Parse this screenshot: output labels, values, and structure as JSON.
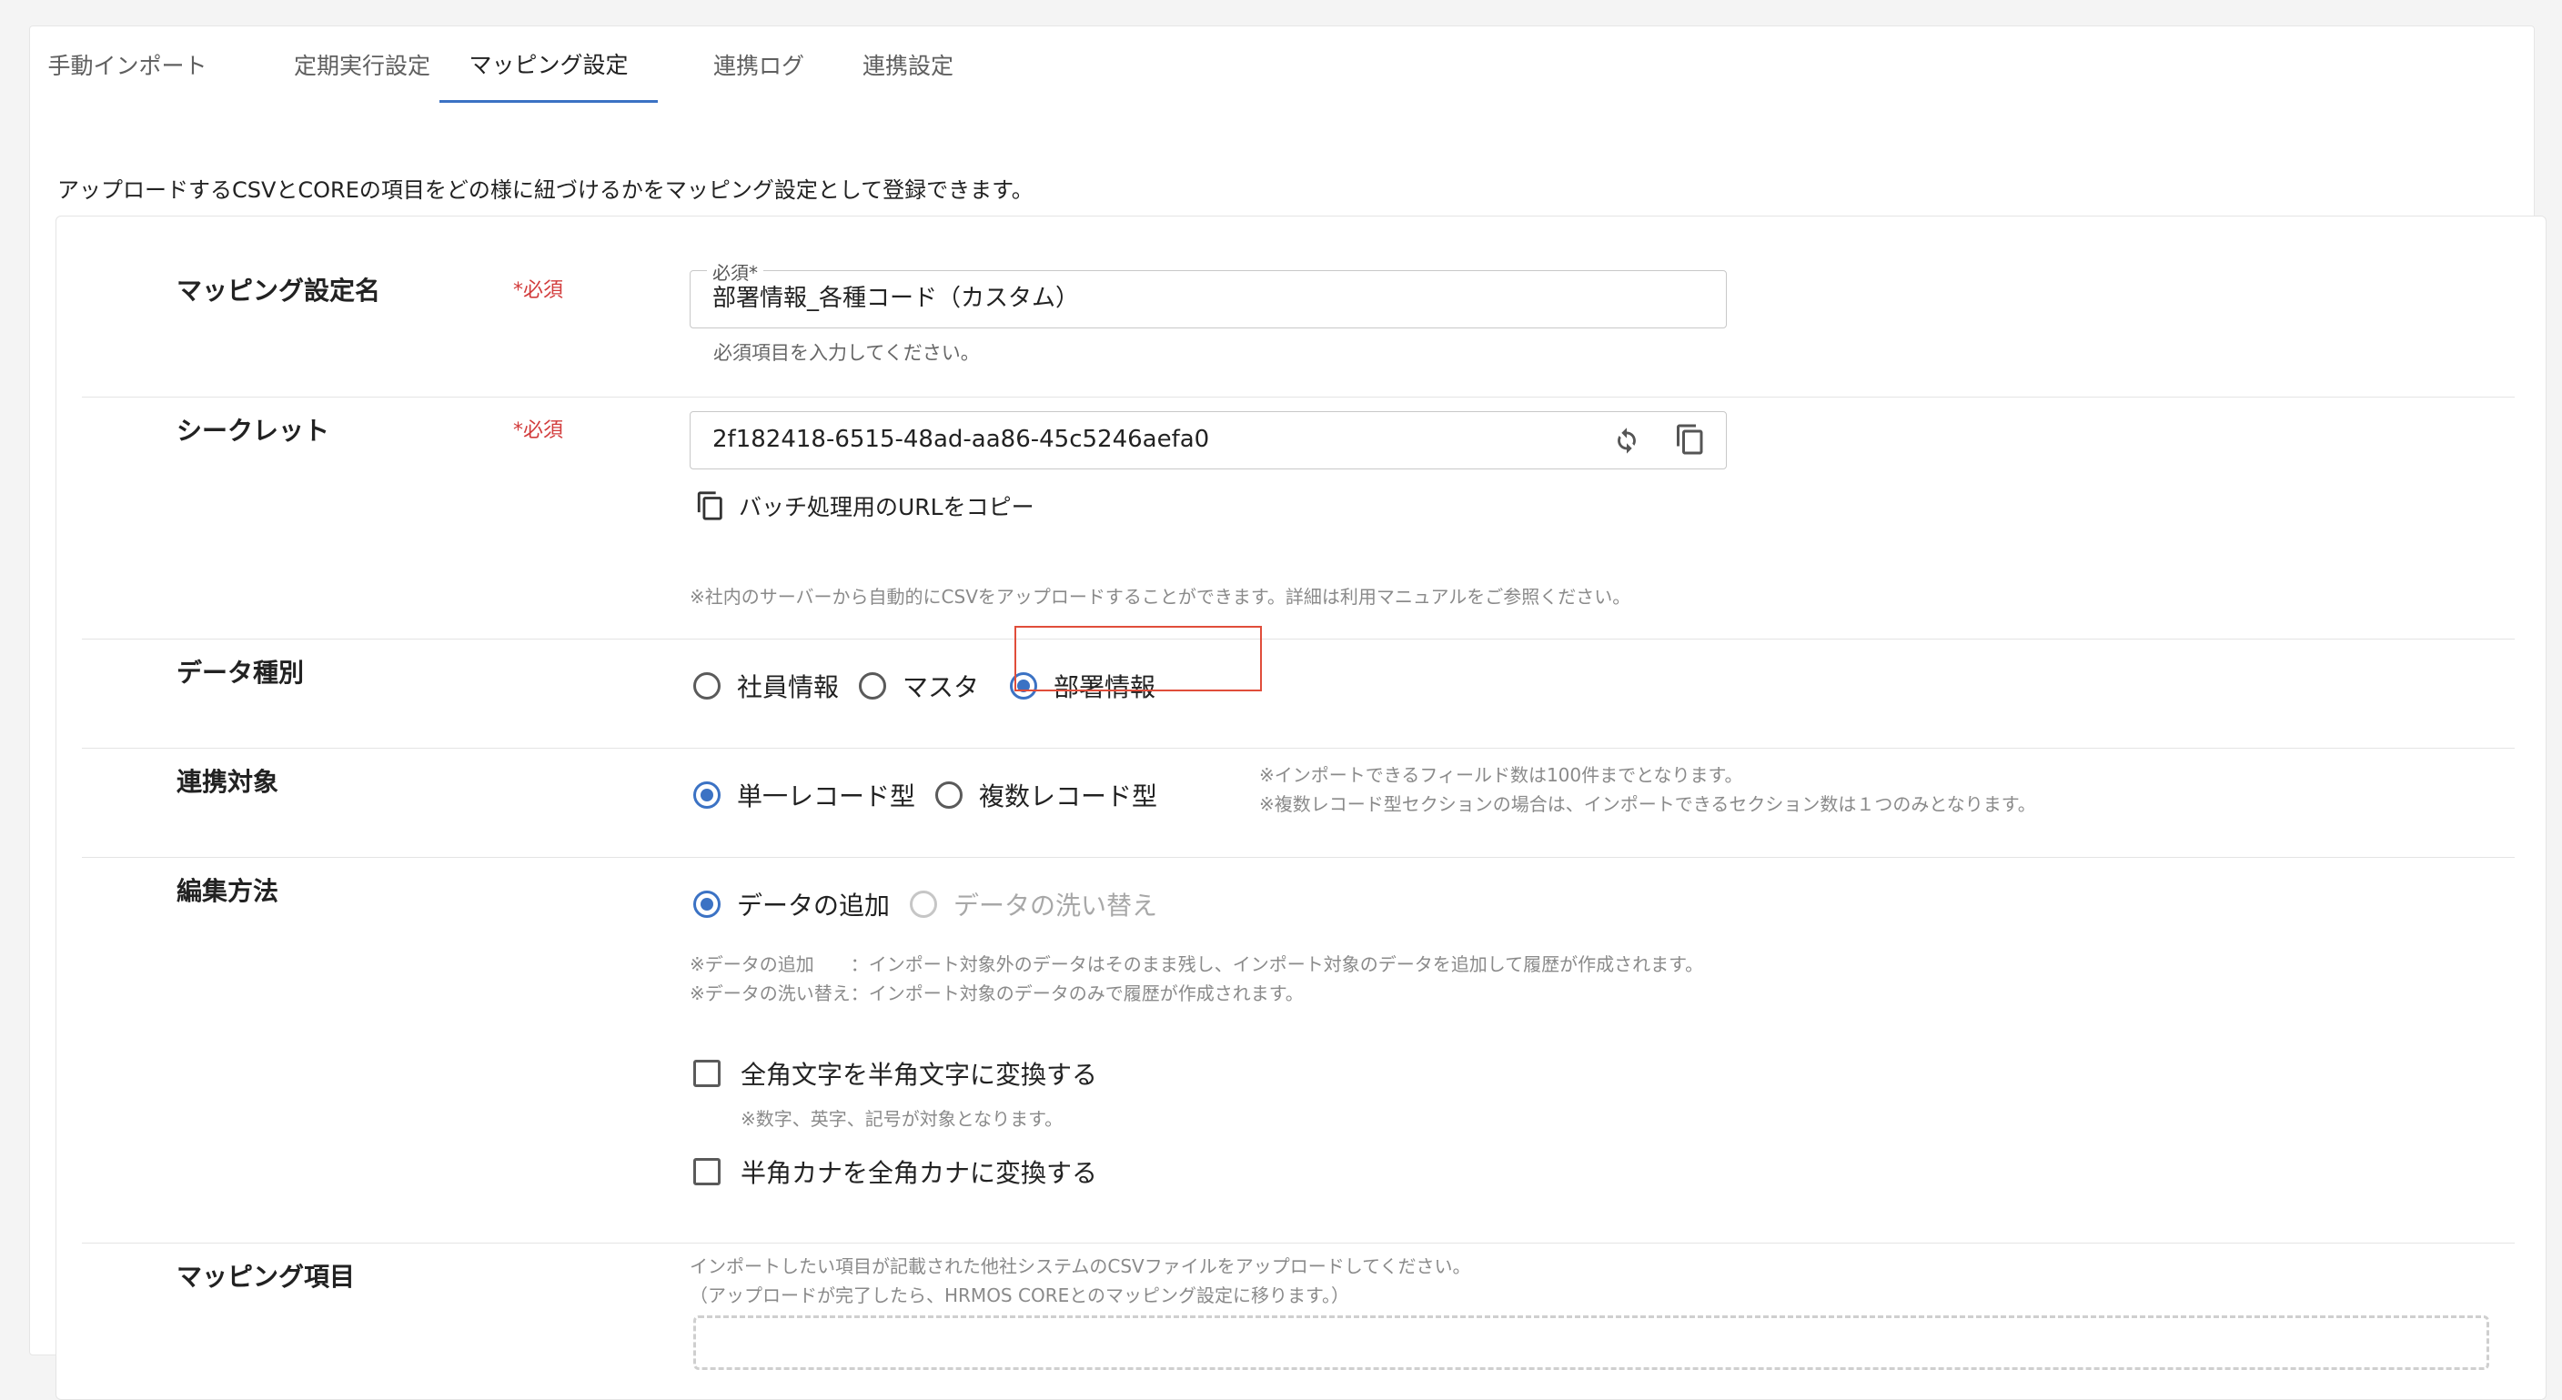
{
  "tabs": [
    {
      "label": "手動インポート"
    },
    {
      "label": "定期実行設定"
    },
    {
      "label": "マッピング設定",
      "active": true
    },
    {
      "label": "連携ログ"
    },
    {
      "label": "連携設定"
    }
  ],
  "intro": "アップロードするCSVとCOREの項目をどの様に紐づけるかをマッピング設定として登録できます。",
  "colors": {
    "accent": "#3b72c4",
    "required": "#d23c3c",
    "highlight": "#e04d3a"
  },
  "mapping_name": {
    "label": "マッピング設定名",
    "required": "*必須",
    "field_label": "必須*",
    "value": "部署情報_各種コード（カスタム）",
    "helper": "必須項目を入力してください。"
  },
  "secret": {
    "label": "シークレット",
    "required": "*必須",
    "value": "2f182418-6515-48ad-aa86-45c5246aefa0",
    "refresh_icon": "refresh-icon",
    "copy_icon": "copy-icon",
    "copy_url_label": "バッチ処理用のURLをコピー",
    "note": "※社内のサーバーから自動的にCSVをアップロードすることができます。詳細は利用マニュアルをご参照ください。"
  },
  "data_type": {
    "label": "データ種別",
    "options": [
      {
        "label": "社員情報",
        "checked": false
      },
      {
        "label": "マスタ",
        "checked": false
      },
      {
        "label": "部署情報",
        "checked": true
      }
    ]
  },
  "target": {
    "label": "連携対象",
    "options": [
      {
        "label": "単一レコード型",
        "checked": true
      },
      {
        "label": "複数レコード型",
        "checked": false
      }
    ],
    "notes": [
      "※インポートできるフィールド数は100件までとなります。",
      "※複数レコード型セクションの場合は、インポートできるセクション数は１つのみとなります。"
    ]
  },
  "edit_method": {
    "label": "編集方法",
    "options": [
      {
        "label": "データの追加",
        "checked": true
      },
      {
        "label": "データの洗い替え",
        "checked": false,
        "disabled": true
      }
    ],
    "notes": [
      "※データの追加　　：インポート対象外のデータはそのまま残し、インポート対象のデータを追加して履歴が作成されます。",
      "※データの洗い替え：インポート対象のデータのみで履歴が作成されます。"
    ],
    "checkbox1": {
      "label": "全角文字を半角文字に変換する",
      "checked": false,
      "note": "※数字、英字、記号が対象となります。"
    },
    "checkbox2": {
      "label": "半角カナを全角カナに変換する",
      "checked": false
    }
  },
  "mapping_items": {
    "label": "マッピング項目",
    "notes": [
      "インポートしたい項目が記載された他社システムのCSVファイルをアップロードしてください。",
      "（アップロードが完了したら、HRMOS COREとのマッピング設定に移ります。）"
    ]
  }
}
